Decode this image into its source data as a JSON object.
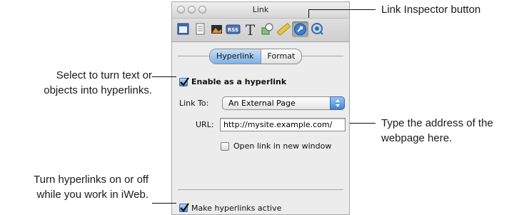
{
  "window": {
    "title": "Link",
    "toolbar_icons": [
      "document-inspector-icon",
      "page-inspector-icon",
      "photo-inspector-icon",
      "rss-inspector-icon",
      "text-inspector-icon",
      "graphic-inspector-icon",
      "metrics-inspector-icon",
      "link-inspector-icon",
      "quicktime-inspector-icon"
    ],
    "toolbar_icon_labels": {
      "rss": "RSS",
      "text": "T"
    },
    "tabs": [
      {
        "label": "Hyperlink",
        "selected": true
      },
      {
        "label": "Format",
        "selected": false
      }
    ],
    "enable_hyperlink": {
      "label": "Enable as a hyperlink",
      "checked": true
    },
    "link_to": {
      "label": "Link To:",
      "value": "An External Page"
    },
    "url": {
      "label": "URL:",
      "value": "http://mysite.example.com/"
    },
    "open_new_window": {
      "label": "Open link in new window",
      "checked": false
    },
    "make_active": {
      "label": "Make hyperlinks active",
      "checked": true
    }
  },
  "callouts": {
    "link_inspector": "Link Inspector button",
    "enable_line1": "Select to turn text or",
    "enable_line2": "objects into hyperlinks.",
    "url_line1": "Type the address of the",
    "url_line2": "webpage here.",
    "active_line1": "Turn hyperlinks on or off",
    "active_line2": "while you work in iWeb."
  },
  "colors": {
    "accent_blue": "#4f8fd8",
    "panel_bg": "#ececec"
  }
}
